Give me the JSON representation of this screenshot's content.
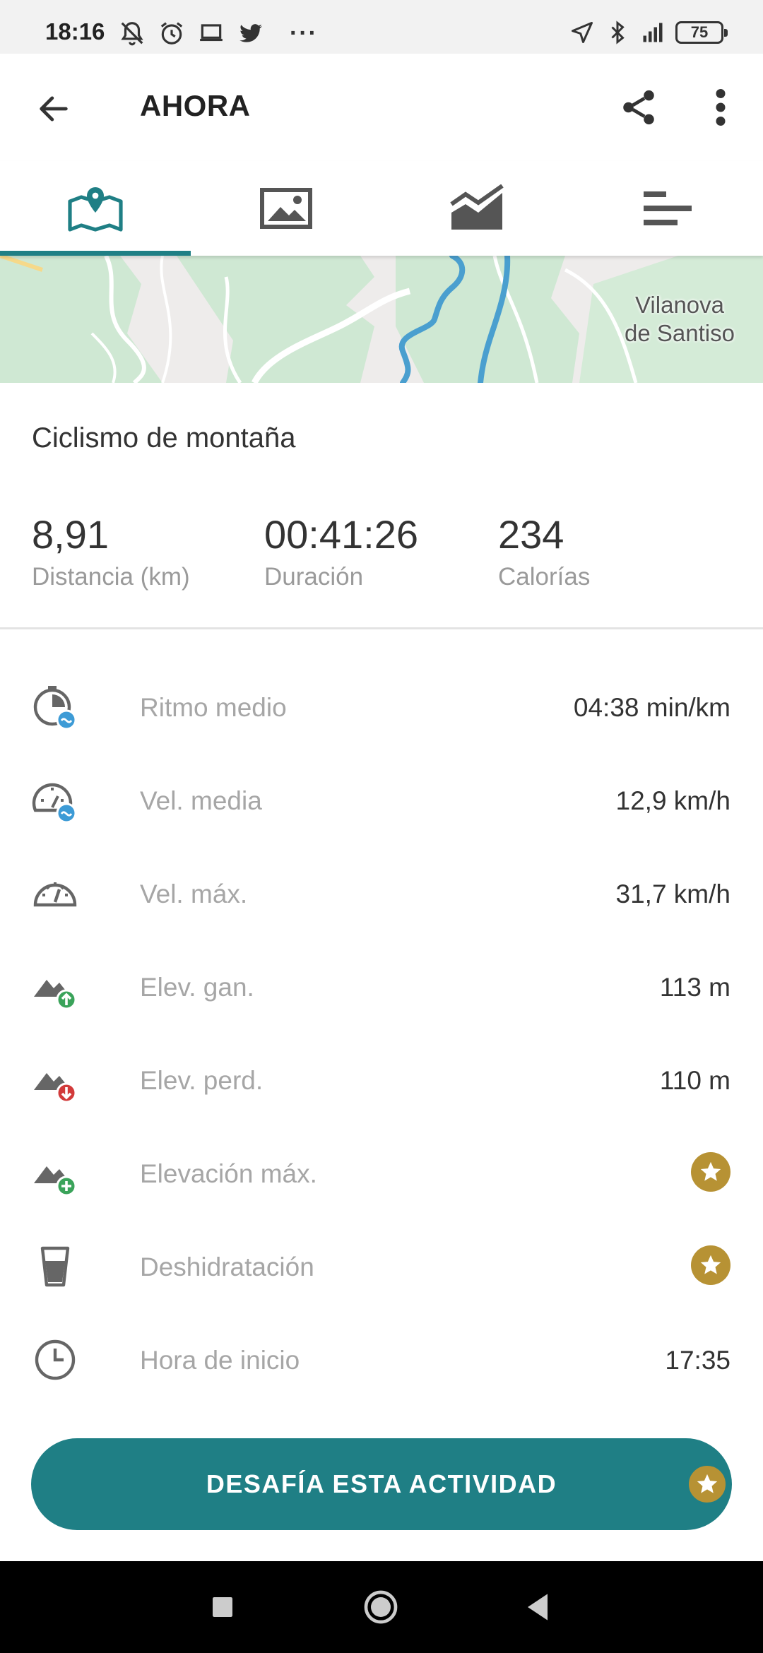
{
  "status_bar": {
    "time": "18:16",
    "battery": "75",
    "left_icons": [
      "silent-icon",
      "alarm-icon",
      "laptop-icon",
      "twitter-icon"
    ],
    "more": "···",
    "right_icons": [
      "location-icon",
      "bluetooth-icon",
      "signal-icon"
    ]
  },
  "header": {
    "title": "AHORA"
  },
  "tabs": [
    {
      "name": "map",
      "icon": "map-pin-icon",
      "active": true
    },
    {
      "name": "photos",
      "icon": "image-icon",
      "active": false
    },
    {
      "name": "graphs",
      "icon": "chart-icon",
      "active": false
    },
    {
      "name": "laps",
      "icon": "bars-icon",
      "active": false
    }
  ],
  "map": {
    "place_line1": "Vilanova",
    "place_line2": "de Santiso"
  },
  "activity": {
    "sport": "Ciclismo de montaña"
  },
  "summary": [
    {
      "value": "8,91",
      "label": "Distancia (km)"
    },
    {
      "value": "00:41:26",
      "label": "Duración"
    },
    {
      "value": "234",
      "label": "Calorías"
    }
  ],
  "metrics": [
    {
      "label": "Ritmo medio",
      "value": "04:38 min/km",
      "icon": "pace-icon"
    },
    {
      "label": "Vel. media",
      "value": "12,9 km/h",
      "icon": "avg-speed-icon"
    },
    {
      "label": "Vel. máx.",
      "value": "31,7 km/h",
      "icon": "speedometer-icon"
    },
    {
      "label": "Elev. gan.",
      "value": "113 m",
      "icon": "elevation-gain-icon"
    },
    {
      "label": "Elev. perd.",
      "value": "110 m",
      "icon": "elevation-loss-icon"
    },
    {
      "label": "Elevación máx.",
      "value": "",
      "icon": "elevation-max-icon",
      "premium": true
    },
    {
      "label": "Deshidratación",
      "value": "",
      "icon": "glass-icon",
      "premium": true
    },
    {
      "label": "Hora de inicio",
      "value": "17:35",
      "icon": "clock-icon"
    }
  ],
  "cta": {
    "label": "DESAFÍA ESTA ACTIVIDAD"
  },
  "colors": {
    "accent": "#1f7f85",
    "premium_gold": "#b79234",
    "gain_green": "#3aa35a",
    "loss_red": "#d23a3a",
    "info_blue": "#3d9bd6"
  }
}
